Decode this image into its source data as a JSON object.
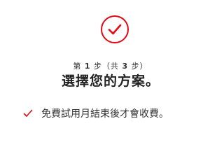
{
  "header": {
    "icon": "check-circle-icon",
    "step_prefix": "第",
    "step_current": "1",
    "step_middle": "步（共",
    "step_total": "3",
    "step_suffix": "步）",
    "title": "選擇您的方案。"
  },
  "benefits": [
    {
      "icon": "checkmark-icon",
      "text": "免費試用月結束後才會收費。"
    }
  ],
  "colors": {
    "accent": "#e50914",
    "text": "#333333"
  }
}
